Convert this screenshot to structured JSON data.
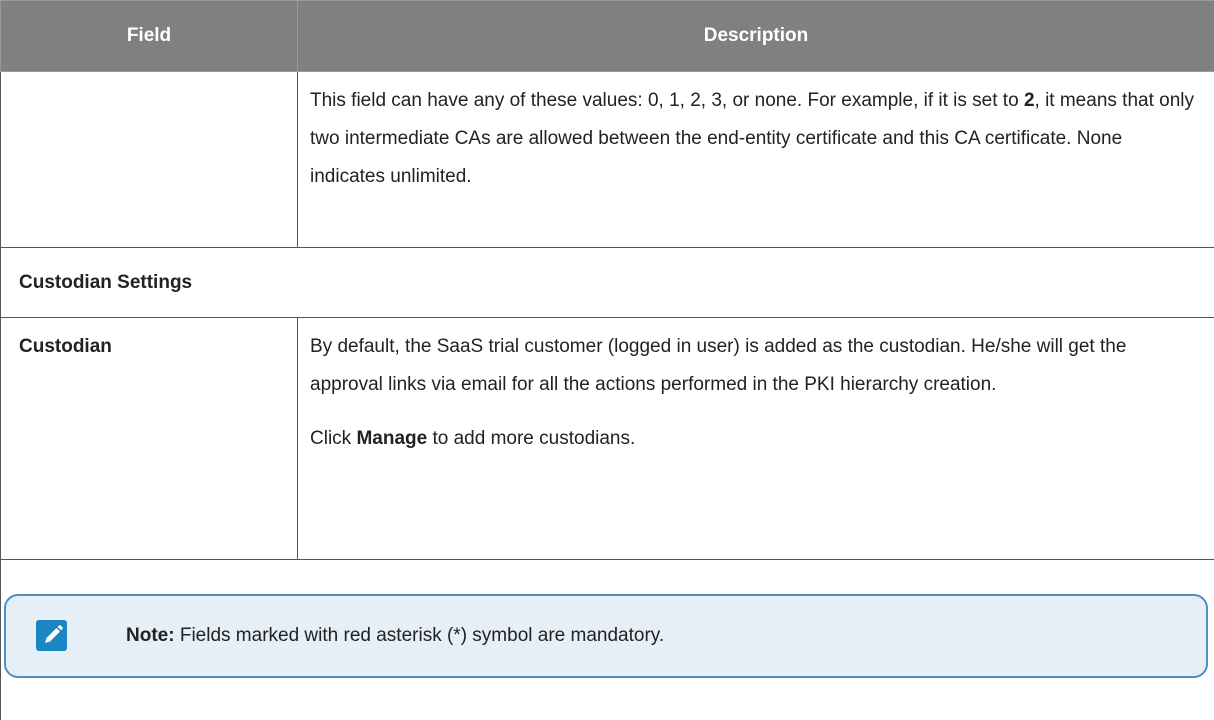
{
  "table": {
    "headers": {
      "field": "Field",
      "description": "Description"
    },
    "continued_row": {
      "field": "",
      "description_parts": {
        "before": "This field can have any of these values: 0, 1, 2, 3, or none. For example, if it is set to ",
        "bold": "2",
        "after": ", it means that only two intermediate CAs are allowed between the end-entity certificate and this CA certificate. None indicates unlimited."
      }
    },
    "section_heading": "Custodian Settings",
    "custodian_row": {
      "field": "Custodian",
      "paragraph1": "By default, the SaaS trial customer (logged in user) is added as the custodian. He/she will get the approval links via email for all the actions performed in the PKI hierarchy creation.",
      "paragraph2": {
        "before": "Click ",
        "bold": "Manage",
        "after": " to add more custodians."
      }
    }
  },
  "note": {
    "icon": "pencil-note-icon",
    "label": "Note:",
    "text": " Fields marked with red asterisk (*) symbol are mandatory."
  },
  "colors": {
    "header_bg": "#808080",
    "header_text": "#ffffff",
    "note_bg": "#e6eef6",
    "note_border": "#4f8fc4",
    "note_icon_bg": "#1b86c4"
  }
}
